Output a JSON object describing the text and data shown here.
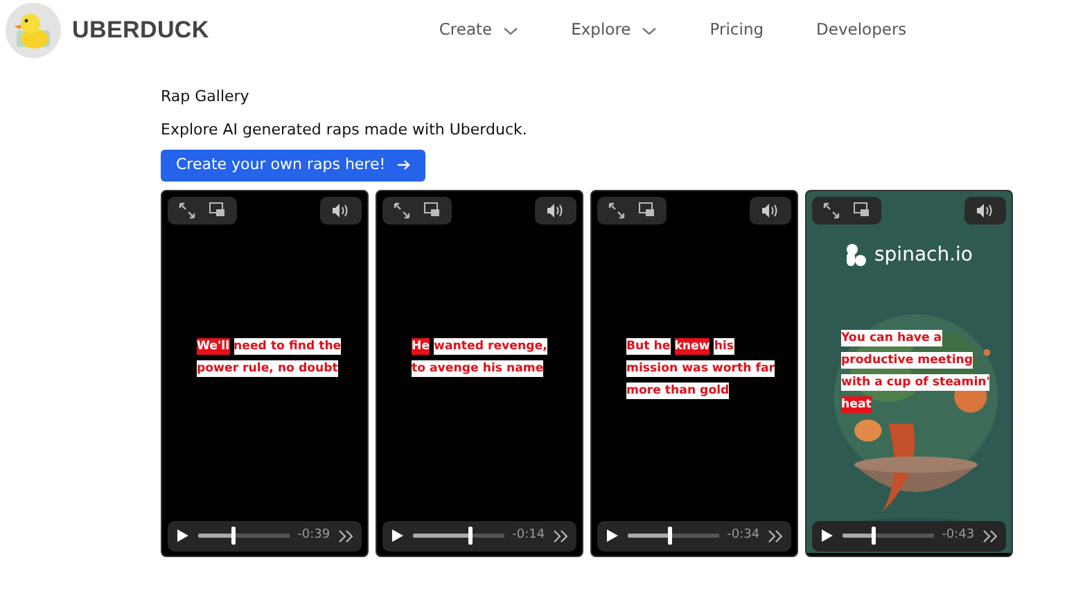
{
  "brand": {
    "name": "UBERDUCK"
  },
  "nav": [
    {
      "label": "Create",
      "kind": "dropdown"
    },
    {
      "label": "Explore",
      "kind": "dropdown"
    },
    {
      "label": "Pricing",
      "kind": "link"
    },
    {
      "label": "Developers",
      "kind": "link"
    }
  ],
  "header": {
    "title": "Rap Gallery",
    "subtitle": "Explore AI generated raps made with Uberduck.",
    "button": "Create your own raps here!"
  },
  "videos": [
    {
      "kind": "plain",
      "words": [
        {
          "text": "We'll",
          "highlighted": true
        },
        {
          "text": "need to find the power rule, no doubt",
          "highlighted": false
        }
      ],
      "level": 0.38,
      "time": "-0:39"
    },
    {
      "kind": "plain",
      "words": [
        {
          "text": "He",
          "highlighted": true
        },
        {
          "text": "wanted revenge, to avenge his name",
          "highlighted": false
        }
      ],
      "level": 0.62,
      "time": "-0:14"
    },
    {
      "kind": "plain",
      "words": [
        {
          "text": "But he",
          "highlighted": false
        },
        {
          "text": "knew",
          "highlighted": true
        },
        {
          "text": "his mission was worth far more than gold",
          "highlighted": false
        }
      ],
      "level": 0.46,
      "time": "-0:34"
    },
    {
      "kind": "picture",
      "logo": "spinach.io",
      "words": [
        {
          "text": "You can have a productive meeting with a cup of steamin'",
          "highlighted": false
        },
        {
          "text": "heat",
          "highlighted": true
        }
      ],
      "level": 0.33,
      "time": "-0:43"
    }
  ]
}
